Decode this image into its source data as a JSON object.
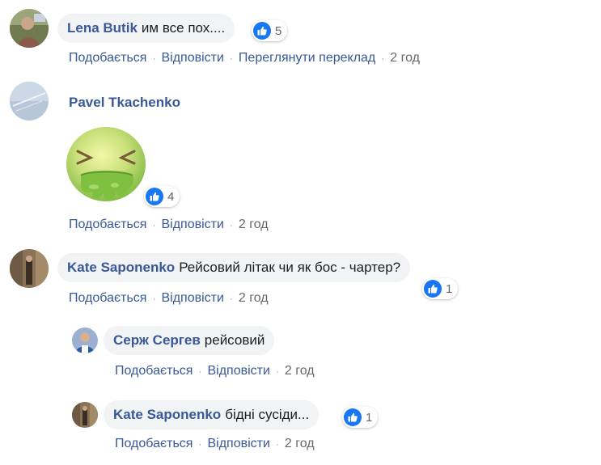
{
  "colors": {
    "link": "#385898",
    "bubble": "#f2f3f5",
    "like_blue": "#1877f2",
    "meta": "#65676b"
  },
  "comments": [
    {
      "author": "Lena Butik",
      "text": "им все пох....",
      "reactions": {
        "icon": "like-icon",
        "count": "5"
      },
      "actions": {
        "like": "Подобається",
        "reply": "Відповісти",
        "translate": "Переглянути переклад",
        "time": "2 год"
      }
    },
    {
      "author": "Pavel Tkachenko",
      "sticker": "sick-face-sticker",
      "reactions": {
        "icon": "like-icon",
        "count": "4"
      },
      "actions": {
        "like": "Подобається",
        "reply": "Відповісти",
        "time": "2 год"
      }
    },
    {
      "author": "Kate Saponenko",
      "text": "Рейсовий літак чи як бос - чартер?",
      "reactions": {
        "icon": "like-icon",
        "count": "1"
      },
      "actions": {
        "like": "Подобається",
        "reply": "Відповісти",
        "time": "2 год"
      },
      "replies": [
        {
          "author": "Серж Сергев",
          "text": "рейсовий",
          "actions": {
            "like": "Подобається",
            "reply": "Відповісти",
            "time": "2 год"
          }
        },
        {
          "author": "Kate Saponenko",
          "text": "бідні сусіди...",
          "reactions": {
            "icon": "like-icon",
            "count": "1"
          },
          "actions": {
            "like": "Подобається",
            "reply": "Відповісти",
            "time": "2 год"
          }
        }
      ]
    }
  ]
}
